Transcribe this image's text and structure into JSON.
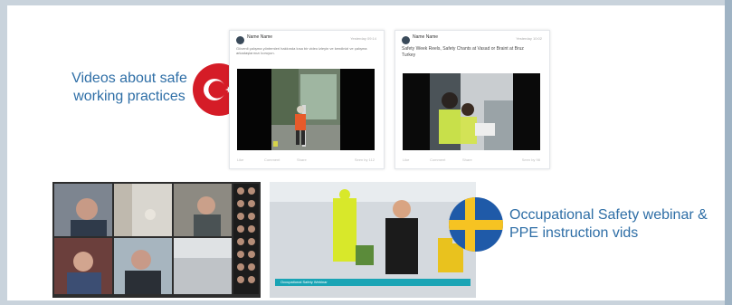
{
  "captions": {
    "turkey": "Videos about safe working practices",
    "sweden": "Occupational Safety webinar & PPE instruction vids"
  },
  "flags": {
    "turkey": {
      "name": "turkey-flag",
      "colors": [
        "#d51c27",
        "#ffffff"
      ]
    },
    "sweden": {
      "name": "sweden-flag",
      "colors": [
        "#1f5aa8",
        "#f6c322"
      ]
    }
  },
  "posts": [
    {
      "author": "Name Name",
      "meta": "Yesterday 09:14",
      "text": "Güvenli çalışma yöntemleri hakkında kısa bir video izleyin ve kendinizi ve çalışma arkadaşlarınızı koruyun.",
      "actions": [
        "Like",
        "Comment",
        "Share",
        "Seen by 112"
      ]
    },
    {
      "author": "Name Name",
      "meta": "Yesterday 10:02",
      "text": "Safety Week Reels, Safety Chants at Vasad or Braint at Bruz Turkey",
      "actions": [
        "Like",
        "Comment",
        "Share",
        "Seen by 98"
      ]
    }
  ],
  "webinar": {
    "lower_third": "Occupational Safety Webinar"
  }
}
